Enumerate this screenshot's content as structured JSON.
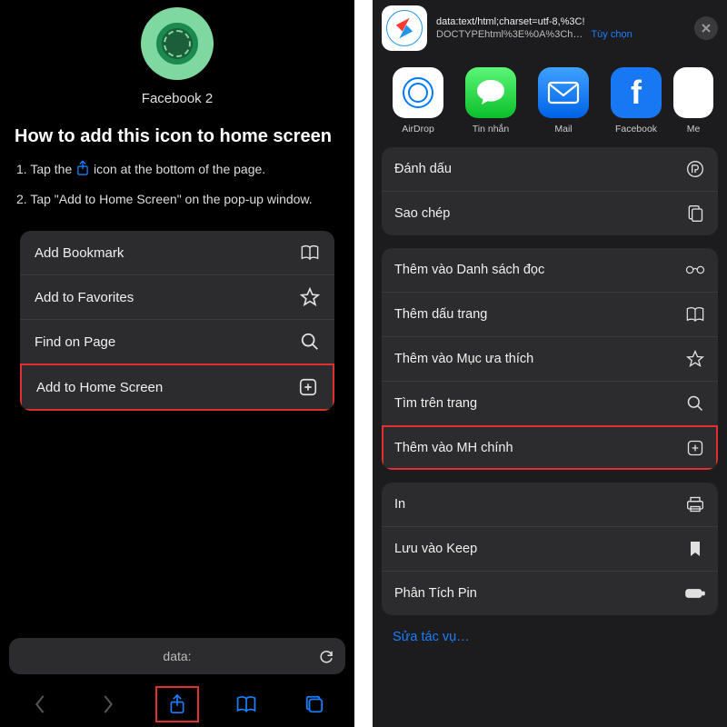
{
  "left": {
    "app_name": "Facebook 2",
    "title": "How to add this icon to home screen",
    "step1a": "1. Tap the",
    "step1b": "icon at the bottom of the page.",
    "step2": "2. Tap \"Add to Home Screen\" on the pop-up window.",
    "menu": {
      "bookmark": "Add Bookmark",
      "favorites": "Add to Favorites",
      "find": "Find on Page",
      "a2hs": "Add to Home Screen"
    },
    "url": "data:"
  },
  "right": {
    "header_line1": "data:text/html;charset=utf-8,%3C!",
    "header_line2": "DOCTYPEhtml%3E%0A%3Ch…",
    "options_label": "Tùy chọn",
    "apps": {
      "airdrop": "AirDrop",
      "messages": "Tin nhắn",
      "mail": "Mail",
      "facebook": "Facebook",
      "mes": "Me"
    },
    "section1": {
      "bookmark": "Đánh dấu",
      "copy": "Sao chép"
    },
    "section2": {
      "reading_list": "Thêm vào Danh sách đọc",
      "add_bookmark": "Thêm dấu trang",
      "favorites": "Thêm vào Mục ưa thích",
      "find": "Tìm trên trang",
      "a2hs": "Thêm vào MH chính"
    },
    "section3": {
      "print": "In",
      "keep": "Lưu vào Keep",
      "pin": "Phân Tích Pin"
    },
    "edit": "Sửa tác vụ…"
  }
}
